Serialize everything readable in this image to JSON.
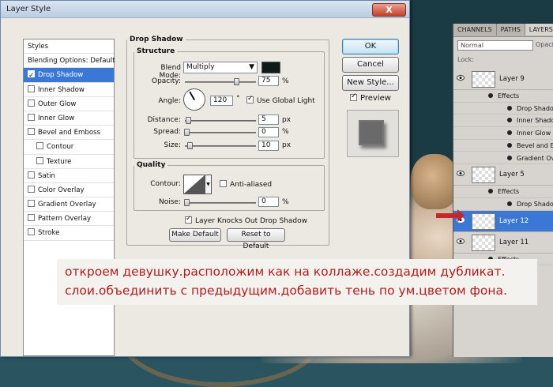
{
  "dialog": {
    "title": "Layer Style",
    "close_label": "X",
    "styles_list": [
      {
        "label": "Styles",
        "kind": "header"
      },
      {
        "label": "Blending Options: Default",
        "kind": "header"
      },
      {
        "label": "Drop Shadow",
        "checked": true,
        "active": true
      },
      {
        "label": "Inner Shadow",
        "checked": false
      },
      {
        "label": "Outer Glow",
        "checked": false
      },
      {
        "label": "Inner Glow",
        "checked": false
      },
      {
        "label": "Bevel and Emboss",
        "checked": false
      },
      {
        "label": "Contour",
        "checked": false,
        "sub": true
      },
      {
        "label": "Texture",
        "checked": false,
        "sub": true
      },
      {
        "label": "Satin",
        "checked": false
      },
      {
        "label": "Color Overlay",
        "checked": false
      },
      {
        "label": "Gradient Overlay",
        "checked": false
      },
      {
        "label": "Pattern Overlay",
        "checked": false
      },
      {
        "label": "Stroke",
        "checked": false
      }
    ],
    "drop_shadow": {
      "title": "Drop Shadow",
      "structure": {
        "title": "Structure",
        "blend_mode_label": "Blend Mode:",
        "blend_mode": "Multiply",
        "shadow_color": "#0e1a17",
        "opacity_label": "Opacity:",
        "opacity": "75",
        "opacity_level": 0.75,
        "angle_label": "Angle:",
        "angle": "120",
        "angle_unit": "°",
        "use_global_light_label": "Use Global Light",
        "use_global_light": true,
        "distance_label": "Distance:",
        "distance": "5",
        "spread_label": "Spread:",
        "spread": "0",
        "size_label": "Size:",
        "size": "10",
        "px": "px",
        "pct": "%"
      },
      "quality": {
        "title": "Quality",
        "contour_label": "Contour:",
        "anti_aliased_label": "Anti-aliased",
        "anti_aliased": false,
        "noise_label": "Noise:",
        "noise": "0",
        "knocks_out_label": "Layer Knocks Out Drop Shadow",
        "knocks_out": true
      },
      "make_default_label": "Make Default",
      "reset_default_label": "Reset to Default"
    },
    "buttons": {
      "ok": "OK",
      "cancel": "Cancel",
      "new_style": "New Style...",
      "preview_label": "Preview",
      "preview_checked": true
    }
  },
  "layers_panel": {
    "tabs": [
      "CHANNELS",
      "PATHS",
      "LAYERS"
    ],
    "blend_mode": "Normal",
    "opacity_label": "Opacity",
    "lock_label": "Lock:",
    "rows": [
      {
        "type": "layer",
        "name": "Layer 9"
      },
      {
        "type": "effect",
        "name": "Effects"
      },
      {
        "type": "effect-sub",
        "name": "Drop Shadow"
      },
      {
        "type": "effect-sub",
        "name": "Inner Shadow"
      },
      {
        "type": "effect-sub",
        "name": "Inner Glow"
      },
      {
        "type": "effect-sub",
        "name": "Bevel and Emboss"
      },
      {
        "type": "effect-sub",
        "name": "Gradient Overlay"
      },
      {
        "type": "layer",
        "name": "Layer 5"
      },
      {
        "type": "effect",
        "name": "Effects"
      },
      {
        "type": "effect-sub",
        "name": "Drop Shadow"
      },
      {
        "type": "layer",
        "name": "Layer 12",
        "selected": true
      },
      {
        "type": "layer",
        "name": "Layer 11"
      },
      {
        "type": "effect",
        "name": "Effects"
      }
    ]
  },
  "caption": {
    "line1": "откроем девушку.расположим как на коллаже.создадим дубликат.",
    "line2": "слои.объединить с предыдущим.добавить тень по ум.цветом фона."
  },
  "colors": {
    "accent": "#3b78d6",
    "caption_text": "#b01c1c"
  }
}
